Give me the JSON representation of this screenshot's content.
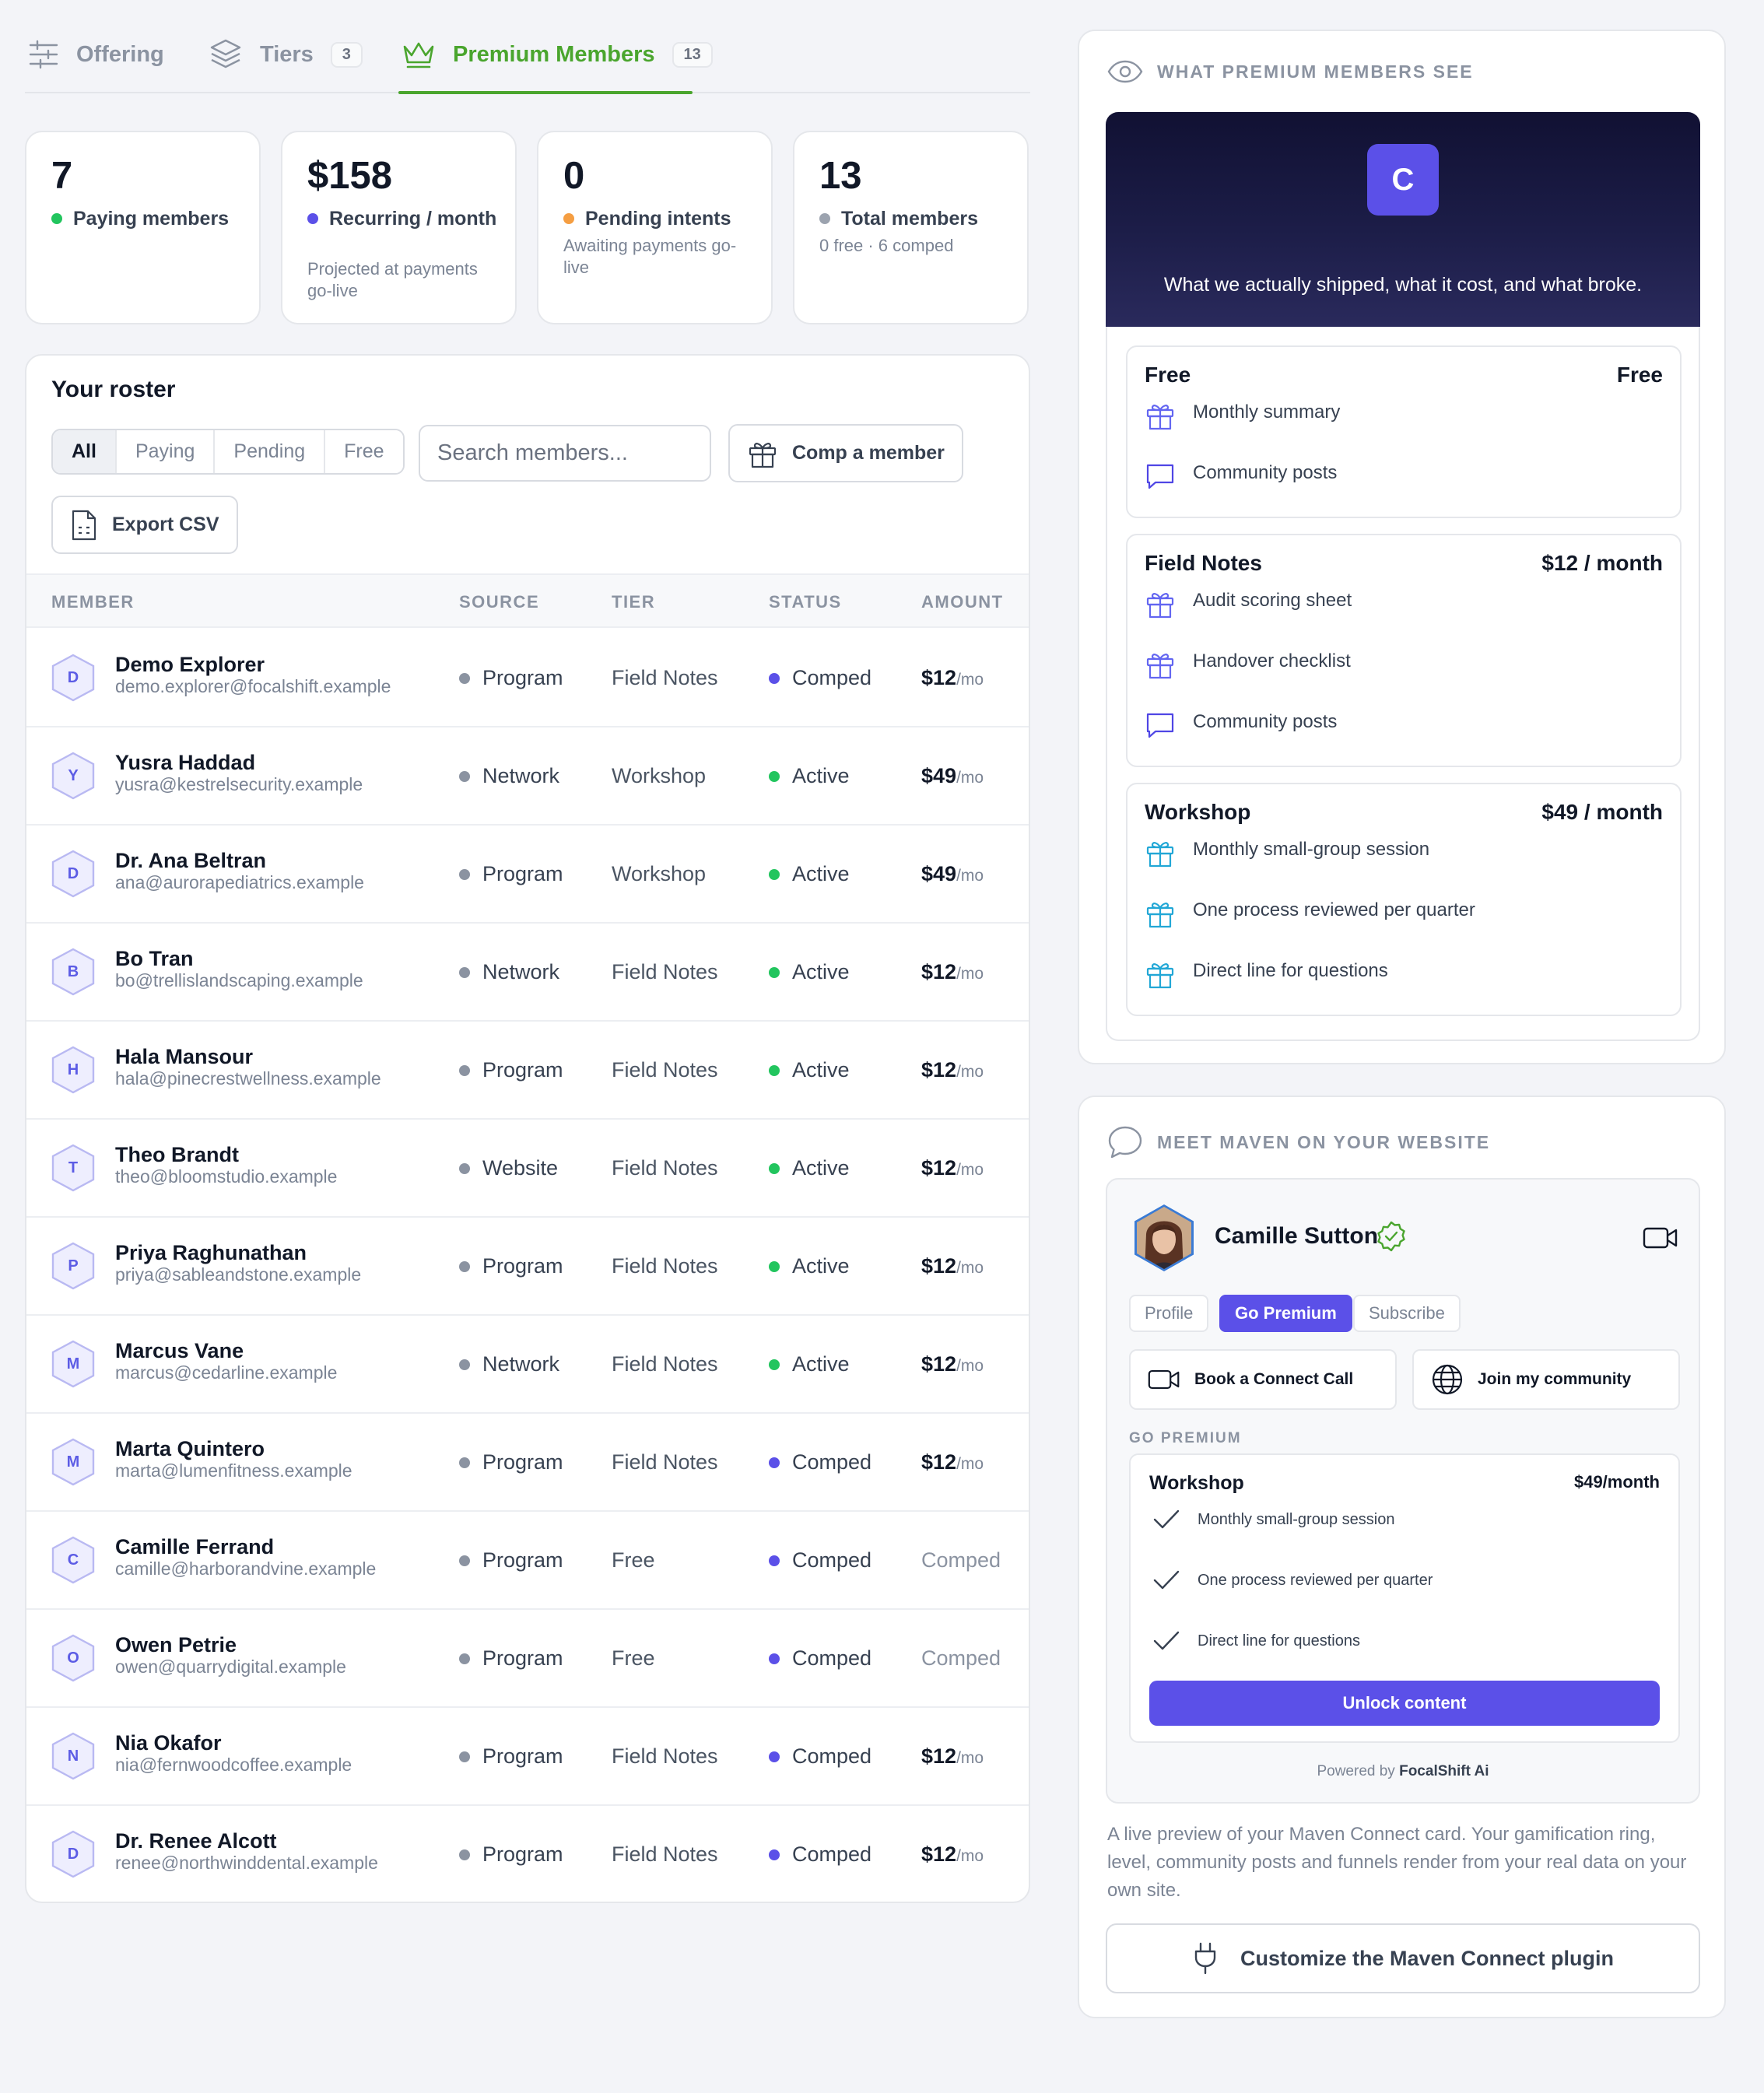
{
  "tabs": [
    {
      "label": "Offering",
      "icon": "sliders-icon"
    },
    {
      "label": "Tiers",
      "count": "3",
      "icon": "layers-icon"
    },
    {
      "label": "Premium Members",
      "count": "13",
      "icon": "crown-icon",
      "active": true
    }
  ],
  "stats": [
    {
      "value": "7",
      "label": "Paying members",
      "dot_color": "#22c55e",
      "sub": ""
    },
    {
      "value": "$158",
      "label": "Recurring / month",
      "dot_color": "#5b50e8",
      "sub": "Projected at payments go-live"
    },
    {
      "value": "0",
      "label": "Pending intents",
      "dot_color": "#f59e42",
      "sub": "Awaiting payments go-live"
    },
    {
      "value": "13",
      "label": "Total members",
      "dot_color": "#9ca3af",
      "sub": "0 free · 6 comped"
    }
  ],
  "roster": {
    "title": "Your roster",
    "filters": [
      "All",
      "Paying",
      "Pending",
      "Free"
    ],
    "active_filter": "All",
    "search_placeholder": "Search members...",
    "comp_button": "Comp a member",
    "export_button": "Export CSV",
    "columns": [
      "MEMBER",
      "SOURCE",
      "TIER",
      "STATUS",
      "AMOUNT"
    ],
    "per_month": "/mo",
    "rows": [
      {
        "initial": "D",
        "name": "Demo Explorer",
        "email": "demo.explorer@focalshift.example",
        "source": "Program",
        "tier": "Field Notes",
        "status": "Comped",
        "amount": "$12"
      },
      {
        "initial": "Y",
        "name": "Yusra Haddad",
        "email": "yusra@kestrelsecurity.example",
        "source": "Network",
        "tier": "Workshop",
        "status": "Active",
        "amount": "$49"
      },
      {
        "initial": "D",
        "name": "Dr. Ana Beltran",
        "email": "ana@aurorapediatrics.example",
        "source": "Program",
        "tier": "Workshop",
        "status": "Active",
        "amount": "$49"
      },
      {
        "initial": "B",
        "name": "Bo Tran",
        "email": "bo@trellislandscaping.example",
        "source": "Network",
        "tier": "Field Notes",
        "status": "Active",
        "amount": "$12"
      },
      {
        "initial": "H",
        "name": "Hala Mansour",
        "email": "hala@pinecrestwellness.example",
        "source": "Program",
        "tier": "Field Notes",
        "status": "Active",
        "amount": "$12"
      },
      {
        "initial": "T",
        "name": "Theo Brandt",
        "email": "theo@bloomstudio.example",
        "source": "Website",
        "tier": "Field Notes",
        "status": "Active",
        "amount": "$12"
      },
      {
        "initial": "P",
        "name": "Priya Raghunathan",
        "email": "priya@sableandstone.example",
        "source": "Program",
        "tier": "Field Notes",
        "status": "Active",
        "amount": "$12"
      },
      {
        "initial": "M",
        "name": "Marcus Vane",
        "email": "marcus@cedarline.example",
        "source": "Network",
        "tier": "Field Notes",
        "status": "Active",
        "amount": "$12"
      },
      {
        "initial": "M",
        "name": "Marta Quintero",
        "email": "marta@lumenfitness.example",
        "source": "Program",
        "tier": "Field Notes",
        "status": "Comped",
        "amount": "$12"
      },
      {
        "initial": "C",
        "name": "Camille Ferrand",
        "email": "camille@harborandvine.example",
        "source": "Program",
        "tier": "Free",
        "status": "Comped",
        "amount": "Comped"
      },
      {
        "initial": "O",
        "name": "Owen Petrie",
        "email": "owen@quarrydigital.example",
        "source": "Program",
        "tier": "Free",
        "status": "Comped",
        "amount": "Comped"
      },
      {
        "initial": "N",
        "name": "Nia Okafor",
        "email": "nia@fernwoodcoffee.example",
        "source": "Program",
        "tier": "Field Notes",
        "status": "Comped",
        "amount": "$12"
      },
      {
        "initial": "D",
        "name": "Dr. Renee Alcott",
        "email": "renee@northwinddental.example",
        "source": "Program",
        "tier": "Field Notes",
        "status": "Comped",
        "amount": "$12"
      }
    ]
  },
  "colors": {
    "accent_green": "#4aa52e",
    "brand_purple": "#5b50e8",
    "status_active": "#22c55e",
    "status_comped": "#5b50e8",
    "source_dot": "#8b93a1"
  },
  "preview": {
    "heading": "WHAT PREMIUM MEMBERS SEE",
    "logo_letter": "C",
    "tagline": "What we actually shipped, what it cost, and what broke.",
    "tiers": [
      {
        "name": "Free",
        "price": "Free",
        "features": [
          {
            "icon": "gift-icon",
            "text": "Monthly summary"
          },
          {
            "icon": "chat-icon",
            "text": "Community posts"
          }
        ]
      },
      {
        "name": "Field Notes",
        "price": "$12 / month",
        "features": [
          {
            "icon": "gift-icon",
            "text": "Audit scoring sheet"
          },
          {
            "icon": "gift-icon",
            "text": "Handover checklist"
          },
          {
            "icon": "chat-icon",
            "text": "Community posts"
          }
        ]
      },
      {
        "name": "Workshop",
        "price": "$49 / month",
        "features": [
          {
            "icon": "gift-icon",
            "text": "Monthly small-group session"
          },
          {
            "icon": "gift-icon",
            "text": "One process reviewed per quarter"
          },
          {
            "icon": "gift-icon",
            "text": "Direct line for questions"
          }
        ]
      }
    ]
  },
  "maven": {
    "heading": "MEET MAVEN ON YOUR WEBSITE",
    "name": "Camille Sutton",
    "tabs": [
      "Profile",
      "Go Premium",
      "Subscribe"
    ],
    "active_tab": "Go Premium",
    "book_call": "Book a Connect Call",
    "join_community": "Join my community",
    "go_premium_label": "GO PREMIUM",
    "plan": {
      "name": "Workshop",
      "price": "$49/month",
      "features": [
        "Monthly small-group session",
        "One process reviewed per quarter",
        "Direct line for questions"
      ]
    },
    "unlock": "Unlock content",
    "powered_prefix": "Powered by",
    "powered_brand": "FocalShift Ai",
    "description": "A live preview of your Maven Connect card. Your gamification ring, level, community posts and funnels render from your real data on your own site.",
    "customize": "Customize the Maven Connect plugin"
  }
}
